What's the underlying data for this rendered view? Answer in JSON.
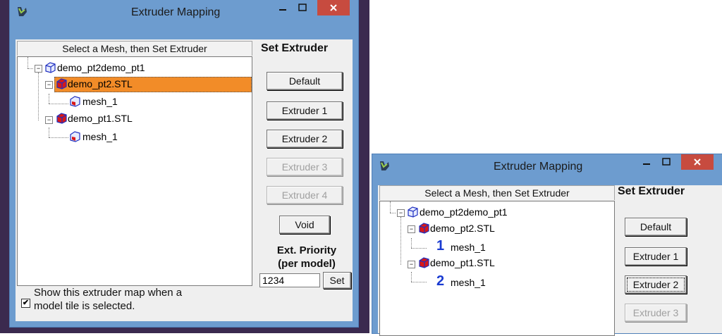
{
  "dialogs": [
    {
      "title": "Extruder Mapping",
      "tree_header": "Select a Mesh, then Set Extruder",
      "set_title": "Set Extruder",
      "buttons": {
        "default": "Default",
        "extruder1": "Extruder 1",
        "extruder2": "Extruder 2",
        "extruder3": "Extruder 3",
        "extruder4": "Extruder 4",
        "void": "Void",
        "set": "Set"
      },
      "priority_label_1": "Ext. Priority",
      "priority_label_2": "(per model)",
      "priority_value": "1234",
      "checkbox_label_1": "Show this extruder map when a",
      "checkbox_label_2": "model tile is selected.",
      "checkbox_mark": "✔",
      "tree": {
        "root": "demo_pt2demo_pt1",
        "child1": "demo_pt2.STL",
        "child1_mesh": "mesh_1",
        "child2": "demo_pt1.STL",
        "child2_mesh": "mesh_1"
      }
    },
    {
      "title": "Extruder Mapping",
      "tree_header": "Select a Mesh, then Set Extruder",
      "set_title": "Set Extruder",
      "buttons": {
        "default": "Default",
        "extruder1": "Extruder 1",
        "extruder2": "Extruder 2",
        "extruder3": "Extruder 3"
      },
      "tree": {
        "root": "demo_pt2demo_pt1",
        "child1": "demo_pt2.STL",
        "child1_mesh": "mesh_1",
        "child1_num": "1",
        "child2": "demo_pt1.STL",
        "child2_mesh": "mesh_1",
        "child2_num": "2"
      }
    }
  ],
  "colors": {
    "titlebar": "#6d9ccf",
    "close": "#c74b3f",
    "selection": "#f28c28",
    "extruder_number": "#1a3bd1"
  },
  "icons": [
    "app-logo-icon",
    "minimize-icon",
    "maximize-icon",
    "close-icon",
    "cube-icon",
    "checkbox-check-icon"
  ]
}
